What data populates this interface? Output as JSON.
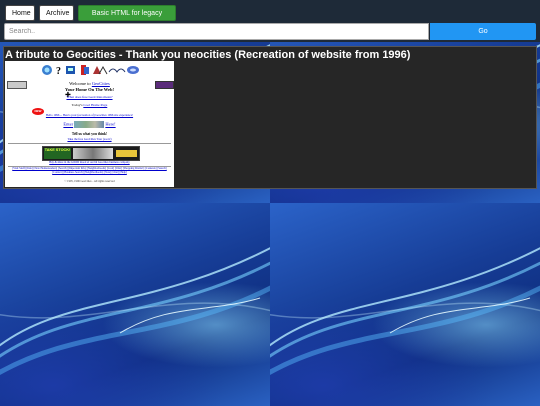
{
  "nav": {
    "home": "Home",
    "archive": "Archive",
    "legacy": "Basic HTML for legacy browsers"
  },
  "search": {
    "placeholder": "Search..",
    "go": "Go"
  },
  "card": {
    "title": "A tribute to Geocities - Thank you neocities (Recreation of website from 1996)"
  },
  "thumb": {
    "welcome": "Welcome to",
    "geocities": "GeoCities",
    "home_on_web": "Your Home On The Web!",
    "what_free": "What does free GeoCities mean?",
    "todays": "Today's",
    "cool_home": "Cool Home Page",
    "new_badge": "NEW",
    "teaser": "Hello 1996 -- Here's your (recreation of) Geocities 1996 site experience!",
    "enter": "Enter",
    "here": "Here!",
    "tell_us": "Tell us what you think!",
    "take_tour": "Take the free GeoCities Tour (soon!)",
    "take_stock": "TAKE STOCK!",
    "banner_note": "Buy & share in the GOOD mood of our hit Geocities business company",
    "neighborhoods": "[Visit Stuff] [Info] [New Homesteaders] [Search] [Important Info] [Neighborhoods] [Cool] [Chat] [Shopping District] [Contests] [Search] [Contact] [Business Search] [Neighborhoods] [Vote] [Chat] [Help]",
    "copyright": "© 1995, 1996 GeoCities - All rights reserved"
  }
}
